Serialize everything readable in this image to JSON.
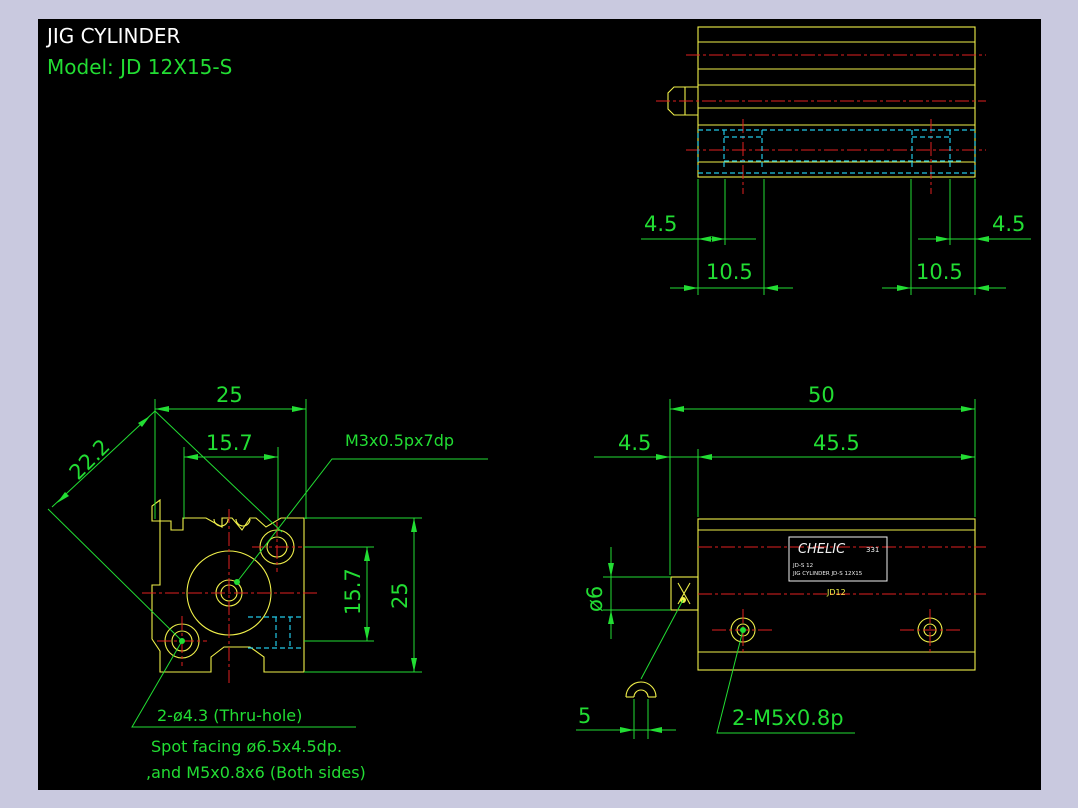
{
  "title": "JIG CYLINDER",
  "model": "Model:  JD 12X15-S",
  "colors": {
    "background": "#000000",
    "outline": "#f0f04a",
    "dimension": "#22dd33",
    "centerline": "#e02020",
    "hidden": "#22c8e6",
    "window_border": "#c9c9df"
  },
  "top_view": {
    "dims": {
      "left_offset": "4.5",
      "left_span": "10.5",
      "right_span": "10.5",
      "right_offset": "4.5"
    }
  },
  "end_view": {
    "dims": {
      "width": "25",
      "diag": "22.2",
      "inner_width": "15.7",
      "inner_height": "15.7",
      "height": "25"
    },
    "notes": {
      "thread": "M3x0.5px7dp",
      "hole": "2-ø4.3 (Thru-hole)",
      "spot": "Spot facing ø6.5x4.5dp.",
      "tap": ",and M5x0.8x6 (Both sides)"
    }
  },
  "side_view": {
    "dims": {
      "total": "50",
      "rod_offset": "4.5",
      "body": "45.5",
      "rod_dia": "ø6",
      "wrench": "5"
    },
    "notes": {
      "port": "2-M5x0.8p"
    },
    "label": {
      "brand": "CHELIC",
      "code": "331",
      "line1": "JD-S 12",
      "line2": "JIG CYLINDER  JD-S 12X15",
      "body_mark": "JD12"
    }
  }
}
